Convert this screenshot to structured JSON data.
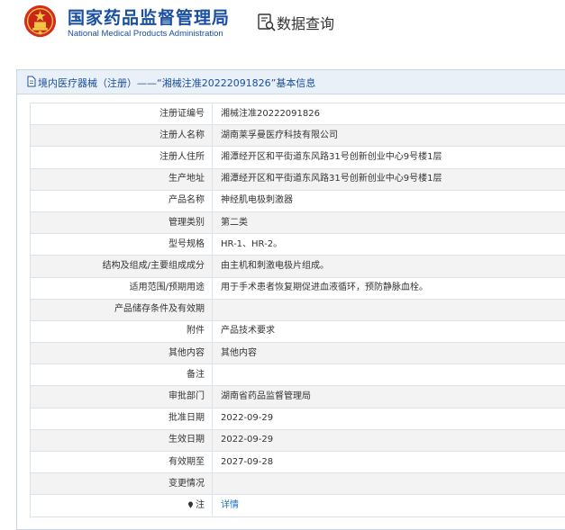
{
  "header": {
    "agency_cn": "国家药品监督管理局",
    "agency_en": "National Medical Products Administration",
    "db_title": "数据查询"
  },
  "panel": {
    "title": "境内医疗器械（注册）——“湘械注准20222091826”基本信息"
  },
  "rows": [
    {
      "label": "注册证编号",
      "value": "湘械注准20222091826"
    },
    {
      "label": "注册人名称",
      "value": "湖南莱孚曼医疗科技有限公司"
    },
    {
      "label": "注册人住所",
      "value": "湘潭经开区和平街道东风路31号创新创业中心9号楼1层"
    },
    {
      "label": "生产地址",
      "value": "湘潭经开区和平街道东风路31号创新创业中心9号楼1层"
    },
    {
      "label": "产品名称",
      "value": "神经肌电极刺激器"
    },
    {
      "label": "管理类别",
      "value": "第二类"
    },
    {
      "label": "型号规格",
      "value": "HR-1、HR-2。"
    },
    {
      "label": "结构及组成/主要组成成分",
      "value": "由主机和刺激电极片组成。"
    },
    {
      "label": "适用范围/预期用途",
      "value": "用于手术患者恢复期促进血液循环，预防静脉血栓。"
    },
    {
      "label": "产品储存条件及有效期",
      "value": ""
    },
    {
      "label": "附件",
      "value": "产品技术要求"
    },
    {
      "label": "其他内容",
      "value": "其他内容"
    },
    {
      "label": "备注",
      "value": ""
    },
    {
      "label": "审批部门",
      "value": "湖南省药品监督管理局"
    },
    {
      "label": "批准日期",
      "value": "2022-09-29"
    },
    {
      "label": "生效日期",
      "value": "2022-09-29"
    },
    {
      "label": "有效期至",
      "value": "2027-09-28"
    },
    {
      "label": "变更情况",
      "value": ""
    }
  ],
  "note_row": {
    "label": "注",
    "link": "详情"
  },
  "colors": {
    "brand_blue": "#1a4fa0",
    "link_blue": "#1a6fc4",
    "panel_head_bg": "#e9f0f8"
  },
  "icons": {
    "emblem": "national-emblem-icon",
    "db": "search-data-icon",
    "panel": "document-icon",
    "note": "location-pin-icon"
  }
}
